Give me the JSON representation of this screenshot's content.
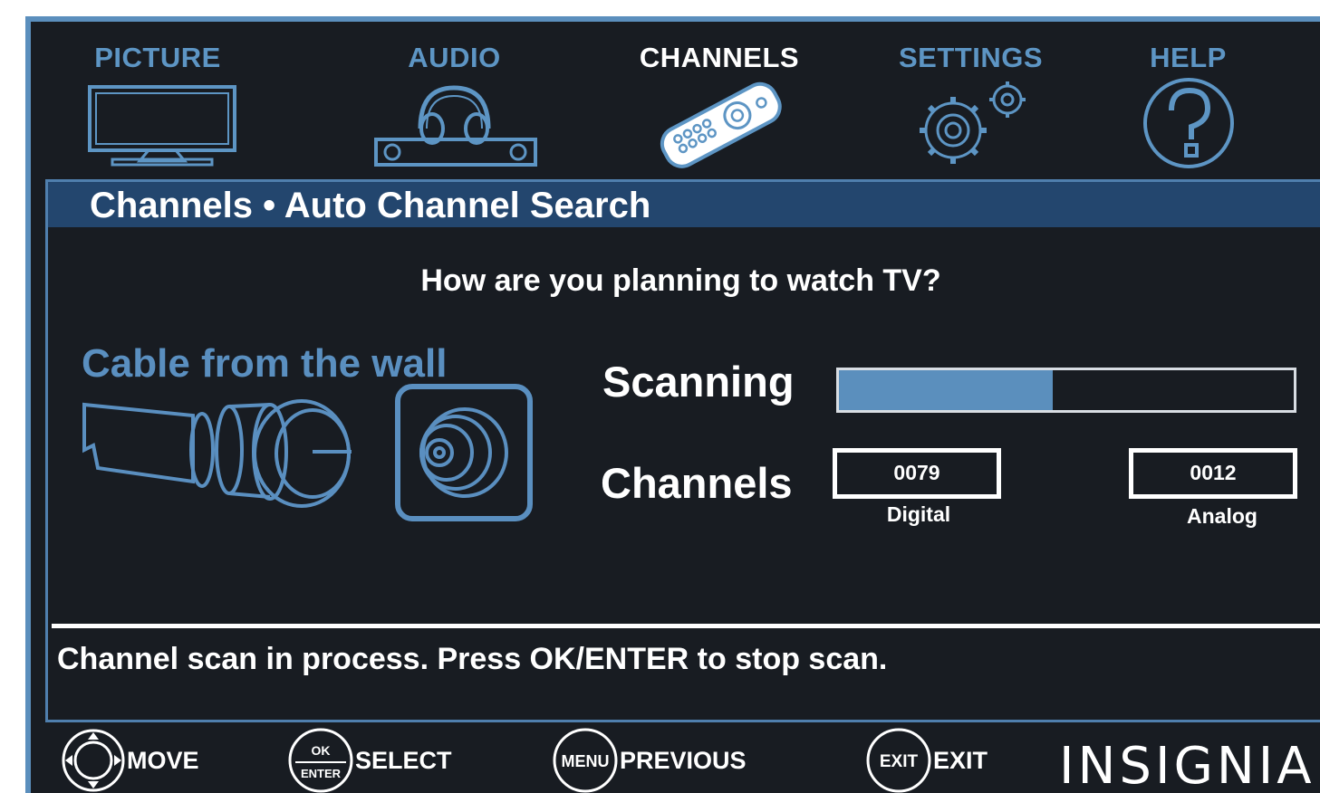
{
  "tabs": [
    {
      "label": "PICTURE",
      "icon": "tv-icon",
      "active": false
    },
    {
      "label": "AUDIO",
      "icon": "headphones-soundbar-icon",
      "active": false
    },
    {
      "label": "CHANNELS",
      "icon": "remote-control-icon",
      "active": true
    },
    {
      "label": "SETTINGS",
      "icon": "gears-icon",
      "active": false
    },
    {
      "label": "HELP",
      "icon": "question-mark-icon",
      "active": false
    }
  ],
  "panel": {
    "title": "Channels • Auto Channel Search",
    "question": "How are you planning to watch TV?",
    "source_label": "Cable from the wall",
    "scanning_label": "Scanning",
    "scan_progress_percent": 47,
    "channels_label": "Channels",
    "digital_count": "0079",
    "digital_caption": "Digital",
    "analog_count": "0012",
    "analog_caption": "Analog",
    "status": "Channel scan in process. Press OK/ENTER to stop scan."
  },
  "footer": {
    "move_label": "MOVE",
    "select_label": "SELECT",
    "ok_icon_top": "OK",
    "ok_icon_bottom": "ENTER",
    "previous_label": "PREVIOUS",
    "menu_icon_text": "MENU",
    "exit_label": "EXIT",
    "exit_icon_text": "EXIT",
    "brand": "INSIGNIA"
  },
  "colors": {
    "background": "#181c22",
    "accent": "#5b8fbd",
    "header_bar": "#23466e",
    "text": "#ffffff"
  }
}
